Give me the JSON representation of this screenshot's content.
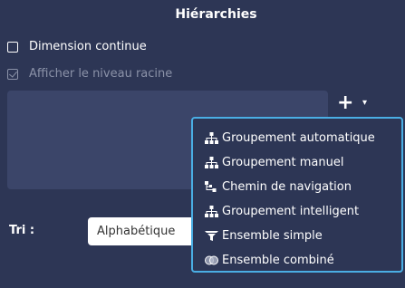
{
  "panel": {
    "title": "Hiérarchies"
  },
  "options": {
    "continuous_dimension": {
      "label": "Dimension continue",
      "checked": false
    },
    "show_root_level": {
      "label": "Afficher le niveau racine",
      "checked": true,
      "disabled": true
    }
  },
  "toolbar": {
    "add_label": "+",
    "caret_label": "▾"
  },
  "sort": {
    "label": "Tri :",
    "value": "Alphabétique"
  },
  "menu": {
    "items": [
      {
        "label": "Groupement automatique",
        "icon": "hierarchy-icon"
      },
      {
        "label": "Groupement manuel",
        "icon": "hierarchy-icon"
      },
      {
        "label": "Chemin de navigation",
        "icon": "navigation-path-icon"
      },
      {
        "label": "Groupement intelligent",
        "icon": "hierarchy-icon"
      },
      {
        "label": "Ensemble simple",
        "icon": "funnel-icon"
      },
      {
        "label": "Ensemble combiné",
        "icon": "combined-set-icon"
      }
    ]
  },
  "colors": {
    "background": "#2d3655",
    "menu_border": "#4aaee4",
    "listbox": "#3b4569"
  }
}
